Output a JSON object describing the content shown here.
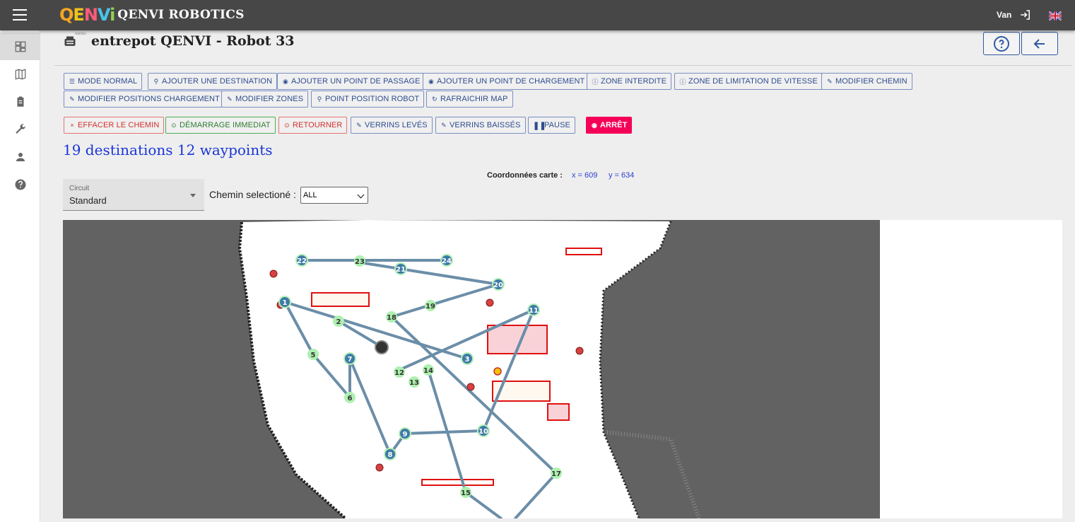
{
  "app": {
    "brand_logo": "QENVi",
    "brand_logo_sub": "ROBOTICS",
    "brand_name": "QENVI ROBOTICS",
    "user": "Van"
  },
  "header": {
    "title": "entrepot QENVI - Robot 33"
  },
  "toolbar_row1": [
    {
      "label": "MODE NORMAL",
      "icon": "list-icon"
    },
    {
      "label": "AJOUTER UNE DESTINATION",
      "icon": "pin-icon"
    },
    {
      "label": "AJOUTER UN POINT DE PASSAGE",
      "icon": "radio-icon"
    },
    {
      "label": "AJOUTER UN POINT DE CHARGEMENT",
      "icon": "radio-icon"
    },
    {
      "label": "ZONE INTERDITE",
      "icon": "info-icon"
    },
    {
      "label": "ZONE DE LIMITATION DE VITESSE",
      "icon": "info-icon"
    },
    {
      "label": "MODIFIER CHEMIN",
      "icon": "edit-icon"
    }
  ],
  "toolbar_row2": [
    {
      "label": "MODIFIER POSITIONS CHARGEMENT",
      "icon": "edit-icon"
    },
    {
      "label": "MODIFIER ZONES",
      "icon": "edit-icon"
    },
    {
      "label": "POINT POSITION ROBOT",
      "icon": "pin-icon"
    },
    {
      "label": "RAFRAICHIR MAP",
      "icon": "refresh-icon"
    }
  ],
  "actions": [
    {
      "label": "EFFACER LE CHEMIN",
      "icon": "close-icon"
    },
    {
      "label": "DÉMARRAGE IMMEDIAT",
      "icon": "play-icon"
    },
    {
      "label": "RETOURNER",
      "icon": "return-icon"
    },
    {
      "label": "VERRINS LEVÉS",
      "icon": "edit-icon"
    },
    {
      "label": "VERRINS BAISSÉS",
      "icon": "edit-icon"
    },
    {
      "label": "PAUSE",
      "icon": "pause-icon"
    },
    {
      "label": "ARRÊT",
      "icon": "stop-icon"
    }
  ],
  "summary": "19 destinations 12 waypoints",
  "coords": {
    "label": "Coordonnées carte :",
    "x": "x = 609",
    "y": "y = 634"
  },
  "circuit": {
    "label": "Circuit",
    "value": "Standard"
  },
  "chemin": {
    "label": "Chemin selectioné :",
    "value": "ALL"
  },
  "map_nodes": [
    {
      "id": "22",
      "kind": "destination"
    },
    {
      "id": "23",
      "kind": "waypoint"
    },
    {
      "id": "21",
      "kind": "destination"
    },
    {
      "id": "24",
      "kind": "destination"
    },
    {
      "id": "20",
      "kind": "destination"
    },
    {
      "id": "1",
      "kind": "destination"
    },
    {
      "id": "2",
      "kind": "waypoint"
    },
    {
      "id": "18",
      "kind": "waypoint"
    },
    {
      "id": "19",
      "kind": "waypoint"
    },
    {
      "id": "11",
      "kind": "destination"
    },
    {
      "id": "5",
      "kind": "waypoint"
    },
    {
      "id": "7",
      "kind": "destination"
    },
    {
      "id": "3",
      "kind": "destination"
    },
    {
      "id": "12",
      "kind": "waypoint"
    },
    {
      "id": "14",
      "kind": "waypoint"
    },
    {
      "id": "13",
      "kind": "waypoint"
    },
    {
      "id": "6",
      "kind": "waypoint"
    },
    {
      "id": "9",
      "kind": "destination"
    },
    {
      "id": "10",
      "kind": "destination"
    },
    {
      "id": "8",
      "kind": "destination"
    },
    {
      "id": "17",
      "kind": "waypoint"
    },
    {
      "id": "15",
      "kind": "waypoint"
    }
  ]
}
